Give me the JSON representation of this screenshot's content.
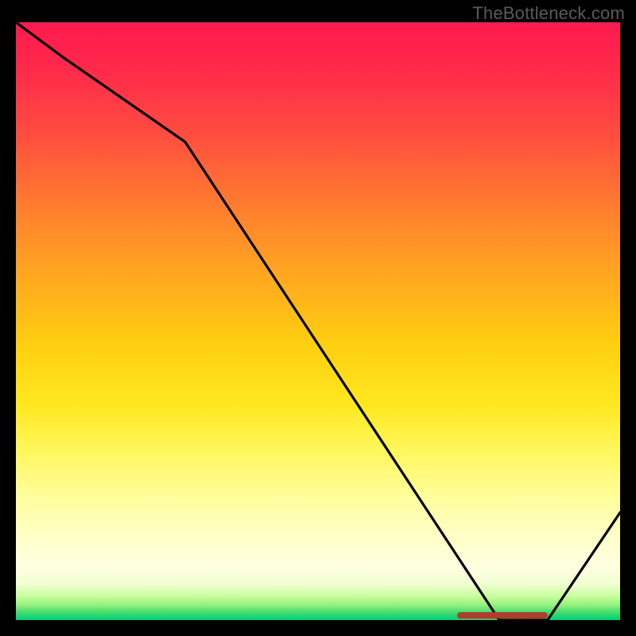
{
  "watermark": "TheBottleneck.com",
  "chart_data": {
    "type": "line",
    "title": "",
    "xlabel": "",
    "ylabel": "",
    "xlim": [
      0,
      100
    ],
    "ylim": [
      0,
      100
    ],
    "grid": false,
    "legend": false,
    "series": [
      {
        "name": "bottleneck-curve",
        "x": [
          0,
          8,
          28,
          80,
          88,
          100
        ],
        "values": [
          100,
          94,
          80,
          0,
          0,
          18
        ]
      }
    ],
    "annotations": [
      {
        "name": "optimum-range",
        "x_start": 73,
        "x_end": 88,
        "y": 0
      }
    ],
    "background_gradient": {
      "top": "#ff1a4f",
      "mid": "#ffe820",
      "bottom": "#00cf78"
    }
  },
  "colors": {
    "background": "#000000",
    "curve": "#000000",
    "marker": "#b33a2e",
    "watermark": "#5a5a5a"
  }
}
